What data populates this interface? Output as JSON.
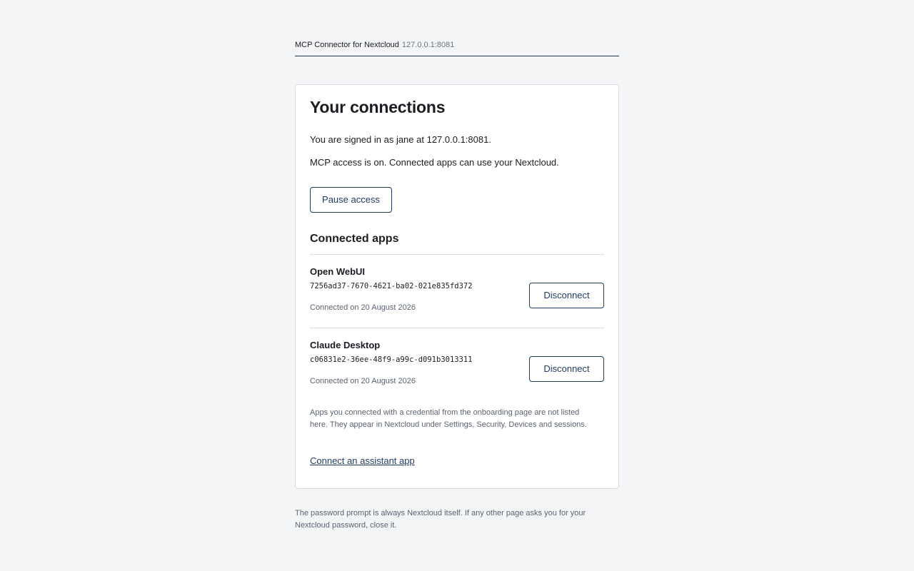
{
  "header": {
    "app_title": "MCP Connector for Nextcloud",
    "host": "127.0.0.1:8081"
  },
  "card": {
    "title": "Your connections",
    "signed_in_text": "You are signed in as jane at 127.0.0.1:8081.",
    "access_status_text": "MCP access is on. Connected apps can use your Nextcloud.",
    "pause_button_label": "Pause access",
    "connected_apps_heading": "Connected apps",
    "apps": [
      {
        "name": "Open WebUI",
        "client_id": "7256ad37-7670-4621-ba02-021e835fd372",
        "connected_on": "Connected on 20 August 2026",
        "disconnect_label": "Disconnect"
      },
      {
        "name": "Claude Desktop",
        "client_id": "c06831e2-36ee-48f9-a99c-d091b3013311",
        "connected_on": "Connected on 20 August 2026",
        "disconnect_label": "Disconnect"
      }
    ],
    "note": "Apps you connected with a credential from the onboarding page are not listed here. They appear in Nextcloud under Settings, Security, Devices and sessions.",
    "connect_link_label": "Connect an assistant app"
  },
  "footer": {
    "note": "The password prompt is always Nextcloud itself. If any other page asks you for your Nextcloud password, close it."
  },
  "colors": {
    "accent": "#1f3a5f",
    "background": "#f4f5f7",
    "card_background": "#ffffff",
    "muted_text": "#5b6270"
  }
}
